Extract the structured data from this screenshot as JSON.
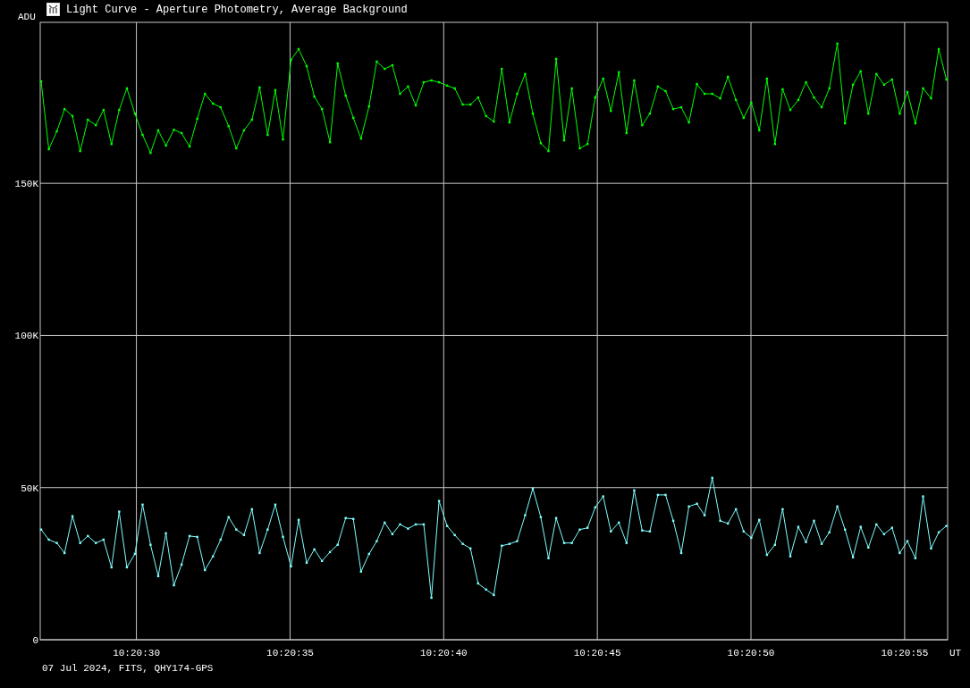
{
  "window": {
    "title": "Light Curve - Aperture Photometry, Average Background"
  },
  "chart_data": {
    "type": "line",
    "grid": true,
    "ylabel": "ADU",
    "xlabel": "UT",
    "xlim": [
      37226.87,
      37256.4
    ],
    "ylim": [
      0,
      202900
    ],
    "xticks": [
      {
        "value": 37230,
        "label": "10:20:30"
      },
      {
        "value": 37235,
        "label": "10:20:35"
      },
      {
        "value": 37240,
        "label": "10:20:40"
      },
      {
        "value": 37245,
        "label": "10:20:45"
      },
      {
        "value": 37250,
        "label": "10:20:50"
      },
      {
        "value": 37255,
        "label": "10:20:55"
      }
    ],
    "yticks": [
      {
        "value": 0,
        "label": "0"
      },
      {
        "value": 50000,
        "label": "50K"
      },
      {
        "value": 100000,
        "label": "100K"
      },
      {
        "value": 150000,
        "label": "150K"
      }
    ],
    "x": [
      37226.9,
      37227.15,
      37227.41,
      37227.66,
      37227.92,
      37228.17,
      37228.42,
      37228.68,
      37228.93,
      37229.19,
      37229.44,
      37229.69,
      37229.95,
      37230.2,
      37230.46,
      37230.71,
      37230.96,
      37231.22,
      37231.47,
      37231.73,
      37231.98,
      37232.23,
      37232.49,
      37232.74,
      37233.0,
      37233.25,
      37233.5,
      37233.76,
      37234.01,
      37234.27,
      37234.52,
      37234.77,
      37235.03,
      37235.28,
      37235.54,
      37235.79,
      37236.04,
      37236.3,
      37236.55,
      37236.81,
      37237.06,
      37237.31,
      37237.57,
      37237.82,
      37238.08,
      37238.33,
      37238.58,
      37238.84,
      37239.09,
      37239.35,
      37239.6,
      37239.85,
      37240.11,
      37240.36,
      37240.62,
      37240.87,
      37241.12,
      37241.38,
      37241.63,
      37241.89,
      37242.14,
      37242.39,
      37242.65,
      37242.9,
      37243.16,
      37243.41,
      37243.66,
      37243.92,
      37244.17,
      37244.43,
      37244.68,
      37244.93,
      37245.19,
      37245.44,
      37245.7,
      37245.95,
      37246.2,
      37246.46,
      37246.71,
      37246.97,
      37247.22,
      37247.47,
      37247.73,
      37247.98,
      37248.24,
      37248.49,
      37248.74,
      37249.0,
      37249.25,
      37249.51,
      37249.76,
      37250.01,
      37250.27,
      37250.52,
      37250.78,
      37251.03,
      37251.28,
      37251.54,
      37251.79,
      37252.05,
      37252.3,
      37252.55,
      37252.81,
      37253.06,
      37253.32,
      37253.57,
      37253.82,
      37254.08,
      37254.33,
      37254.59,
      37254.84,
      37255.09,
      37255.35,
      37255.6,
      37255.86,
      37256.11,
      37256.36
    ],
    "series": [
      {
        "color": "#00ff00",
        "marker": "square",
        "values": [
          183500,
          161200,
          167100,
          174400,
          172100,
          160600,
          170900,
          169100,
          174100,
          162900,
          174100,
          181200,
          172900,
          165900,
          160000,
          167400,
          162400,
          167600,
          166500,
          162100,
          171200,
          179400,
          176200,
          175000,
          168800,
          161500,
          167400,
          170900,
          181500,
          165900,
          180600,
          164400,
          190600,
          194100,
          188500,
          178500,
          174400,
          163500,
          189400,
          178800,
          171500,
          164700,
          175300,
          190000,
          187600,
          188800,
          179400,
          181800,
          175600,
          183200,
          183800,
          183200,
          182100,
          181200,
          175900,
          175900,
          178200,
          172100,
          170300,
          187600,
          170000,
          179400,
          185900,
          172900,
          163200,
          160600,
          190900,
          164100,
          181200,
          161500,
          162900,
          178200,
          184400,
          173800,
          186500,
          166500,
          183800,
          169100,
          172900,
          181800,
          180300,
          174400,
          175000,
          170000,
          182600,
          179400,
          179400,
          177900,
          185000,
          177400,
          171500,
          176500,
          167400,
          184400,
          162900,
          180900,
          174100,
          177400,
          183200,
          178200,
          175000,
          181200,
          195900,
          169700,
          182400,
          186800,
          172900,
          185900,
          182400,
          184100,
          172900,
          180000,
          169700,
          181200,
          177900,
          194100,
          184100
        ]
      },
      {
        "color": "#80ffff",
        "marker": "square",
        "values": [
          36200,
          32900,
          31800,
          28500,
          40600,
          31800,
          34100,
          31800,
          32900,
          23800,
          42100,
          23800,
          28200,
          44400,
          31200,
          20900,
          35000,
          17900,
          24700,
          34100,
          33800,
          22900,
          27400,
          32900,
          40300,
          36200,
          34400,
          42900,
          28500,
          36200,
          44400,
          33800,
          24100,
          39400,
          25300,
          29700,
          25900,
          28800,
          31200,
          40000,
          39700,
          22400,
          28200,
          32400,
          38500,
          34700,
          37900,
          36500,
          37900,
          37900,
          13800,
          45600,
          37400,
          34400,
          31500,
          30000,
          18500,
          16500,
          14700,
          30900,
          31500,
          32400,
          40900,
          49700,
          40300,
          26800,
          40000,
          31800,
          31800,
          36200,
          36800,
          43500,
          47100,
          35600,
          38500,
          31800,
          49100,
          35900,
          35600,
          47600,
          47600,
          39100,
          28500,
          43800,
          44700,
          40900,
          53200,
          39100,
          38200,
          42900,
          35600,
          33500,
          39400,
          27900,
          31200,
          42900,
          27400,
          37100,
          32100,
          39100,
          31500,
          35300,
          43800,
          36200,
          27100,
          37100,
          30300,
          37900,
          34700,
          36800,
          28500,
          32400,
          26800,
          47100,
          30000,
          35300,
          37400
        ]
      }
    ]
  },
  "status_bar": {
    "text": "07 Jul 2024, FITS, QHY174-GPS"
  }
}
